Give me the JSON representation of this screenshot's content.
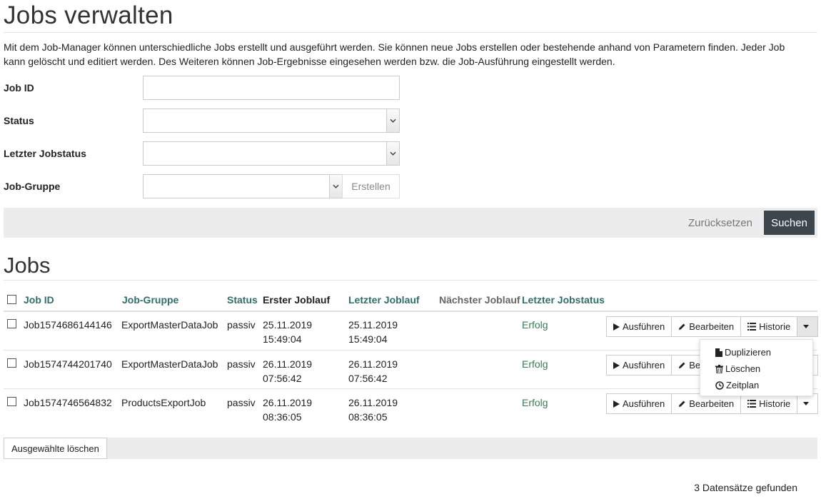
{
  "page": {
    "title": "Jobs verwalten",
    "intro": "Mit dem Job-Manager können unterschiedliche Jobs erstellt und ausgeführt werden. Sie können neue Jobs erstellen oder bestehende anhand von Parametern finden. Jeder Job kann gelöscht und editiert werden. Des Weiteren können Job-Ergebnisse eingesehen werden bzw. die Job-Ausführung eingestellt werden."
  },
  "filters": {
    "job_id_label": "Job ID",
    "job_id_value": "",
    "status_label": "Status",
    "status_value": "",
    "last_status_label": "Letzter Jobstatus",
    "last_status_value": "",
    "group_label": "Job-Gruppe",
    "group_value": "",
    "create_label": "Erstellen",
    "reset_label": "Zurücksetzen",
    "search_label": "Suchen"
  },
  "jobs": {
    "title": "Jobs",
    "columns": {
      "job_id": "Job ID",
      "group": "Job-Gruppe",
      "status": "Status",
      "first_run": "Erster Joblauf",
      "last_run": "Letzter Joblauf",
      "next_run": "Nächster Joblauf",
      "last_status": "Letzter Jobstatus"
    },
    "actions": {
      "run": "Ausführen",
      "edit": "Bearbeiten",
      "history": "Historie"
    },
    "rows": [
      {
        "id": "Job1574686144146",
        "group": "ExportMasterDataJob",
        "status": "passiv",
        "first_date": "25.11.2019",
        "first_time": "15:49:04",
        "last_date": "25.11.2019",
        "last_time": "15:49:04",
        "next_run": "",
        "last_status": "Erfolg"
      },
      {
        "id": "Job1574744201740",
        "group": "ExportMasterDataJob",
        "status": "passiv",
        "first_date": "26.11.2019",
        "first_time": "07:56:42",
        "last_date": "26.11.2019",
        "last_time": "07:56:42",
        "next_run": "",
        "last_status": "Erfolg"
      },
      {
        "id": "Job1574746564832",
        "group": "ProductsExportJob",
        "status": "passiv",
        "first_date": "26.11.2019",
        "first_time": "08:36:05",
        "last_date": "26.11.2019",
        "last_time": "08:36:05",
        "next_run": "",
        "last_status": "Erfolg"
      }
    ],
    "dropdown": {
      "duplicate": "Duplizieren",
      "delete": "Löschen",
      "schedule": "Zeitplan"
    },
    "delete_selected": "Ausgewählte löschen",
    "record_count": "3 Datensätze gefunden"
  },
  "colors": {
    "column_link": "#2f6e6a",
    "status_success": "#3a7a52",
    "primary_button": "#3d464d"
  }
}
